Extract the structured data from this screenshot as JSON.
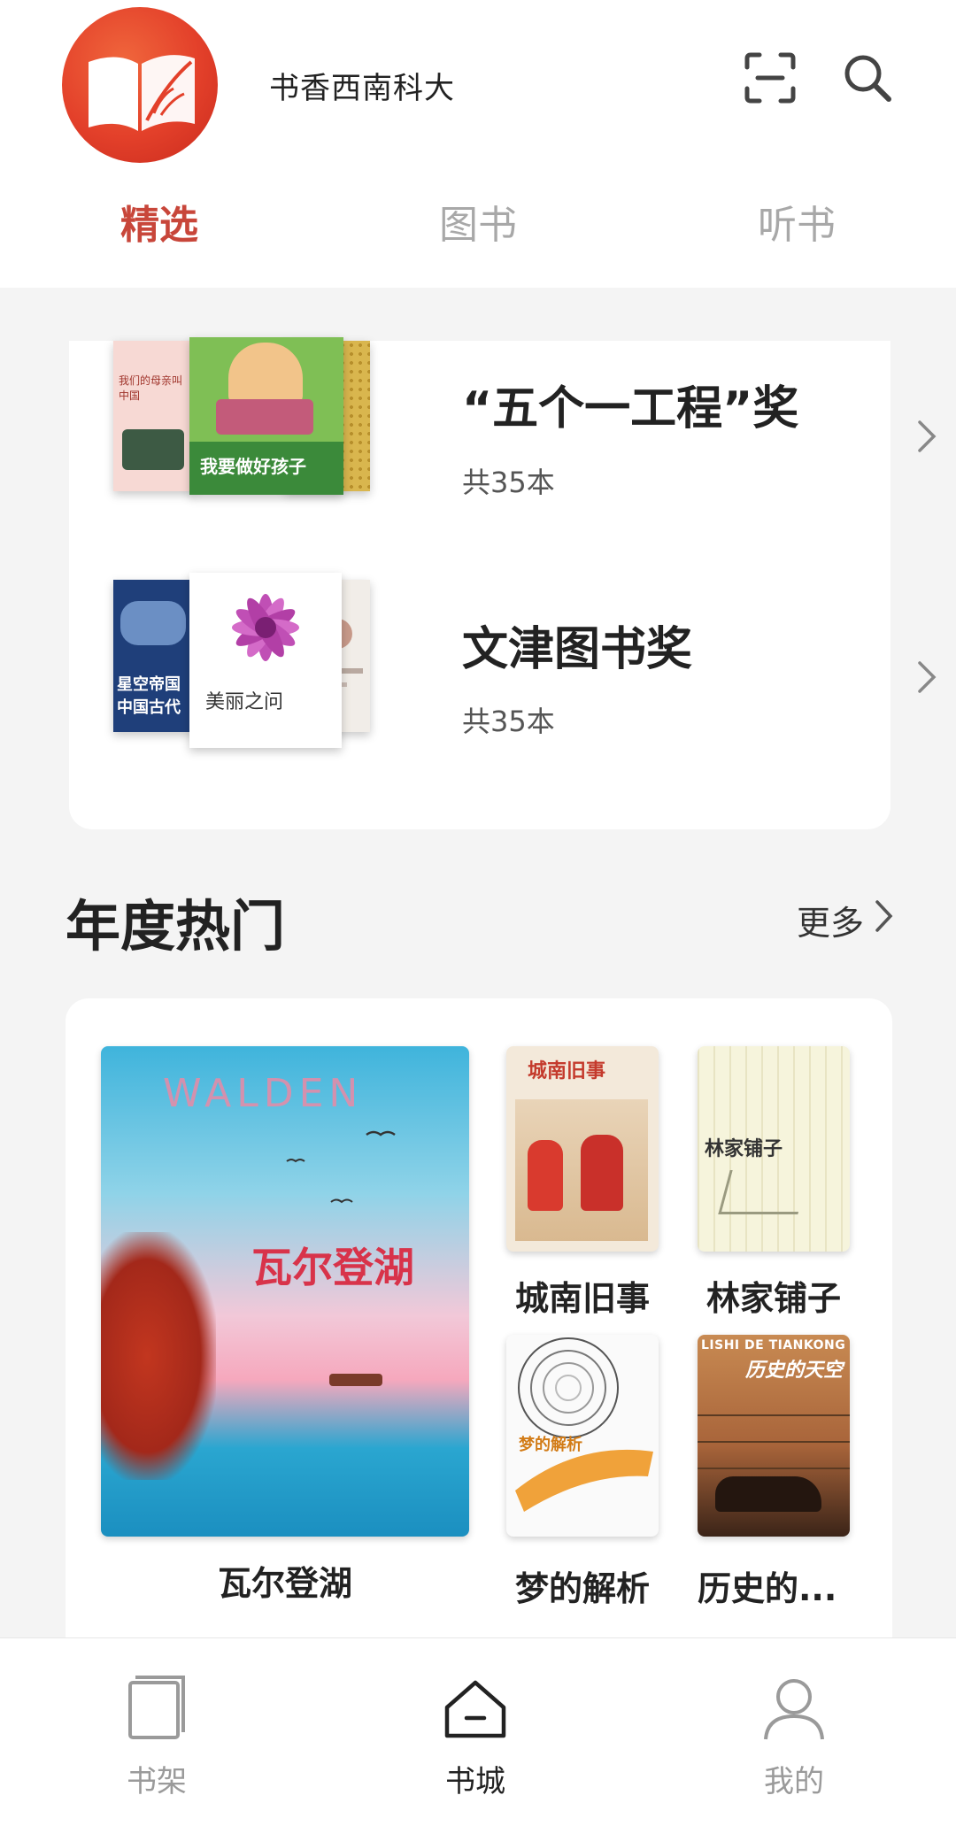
{
  "app": {
    "title": "书香西南科大"
  },
  "tabs": [
    {
      "label": "精选",
      "active": true
    },
    {
      "label": "图书",
      "active": false
    },
    {
      "label": "听书",
      "active": false
    }
  ],
  "awards": [
    {
      "title": "“五个一工程”奖",
      "count": "共35本",
      "covers": [
        {
          "text": "我们的母亲叫中国"
        },
        {
          "text": "我要做好孩子"
        },
        {
          "text": ""
        }
      ]
    },
    {
      "title": "文津图书奖",
      "count": "共35本",
      "covers": [
        {
          "text": "星空帝国 中国古代"
        },
        {
          "text": "美丽之问"
        },
        {
          "text": ""
        }
      ]
    }
  ],
  "section": {
    "title": "年度热门",
    "more": "更多"
  },
  "hot_books": [
    {
      "title": "瓦尔登湖",
      "cover_text": "瓦尔登湖",
      "cover_sub": "WALDEN"
    },
    {
      "title": "城南旧事",
      "cover_text": "城南旧事"
    },
    {
      "title": "林家铺子",
      "cover_text": "林家铺子"
    },
    {
      "title": "梦的解析",
      "cover_text": "梦的解析"
    },
    {
      "title": "历史的...",
      "cover_text": "历史的天空",
      "cover_sub": "LISHI DE TIANKONG"
    }
  ],
  "bottom_nav": [
    {
      "label": "书架",
      "icon": "bookshelf-icon",
      "active": false
    },
    {
      "label": "书城",
      "icon": "bookstore-icon",
      "active": true
    },
    {
      "label": "我的",
      "icon": "profile-icon",
      "active": false
    }
  ],
  "colors": {
    "accent": "#c8463a",
    "logo": "#e3402a",
    "inactive": "#a8a8a8",
    "background": "#f4f4f4"
  }
}
